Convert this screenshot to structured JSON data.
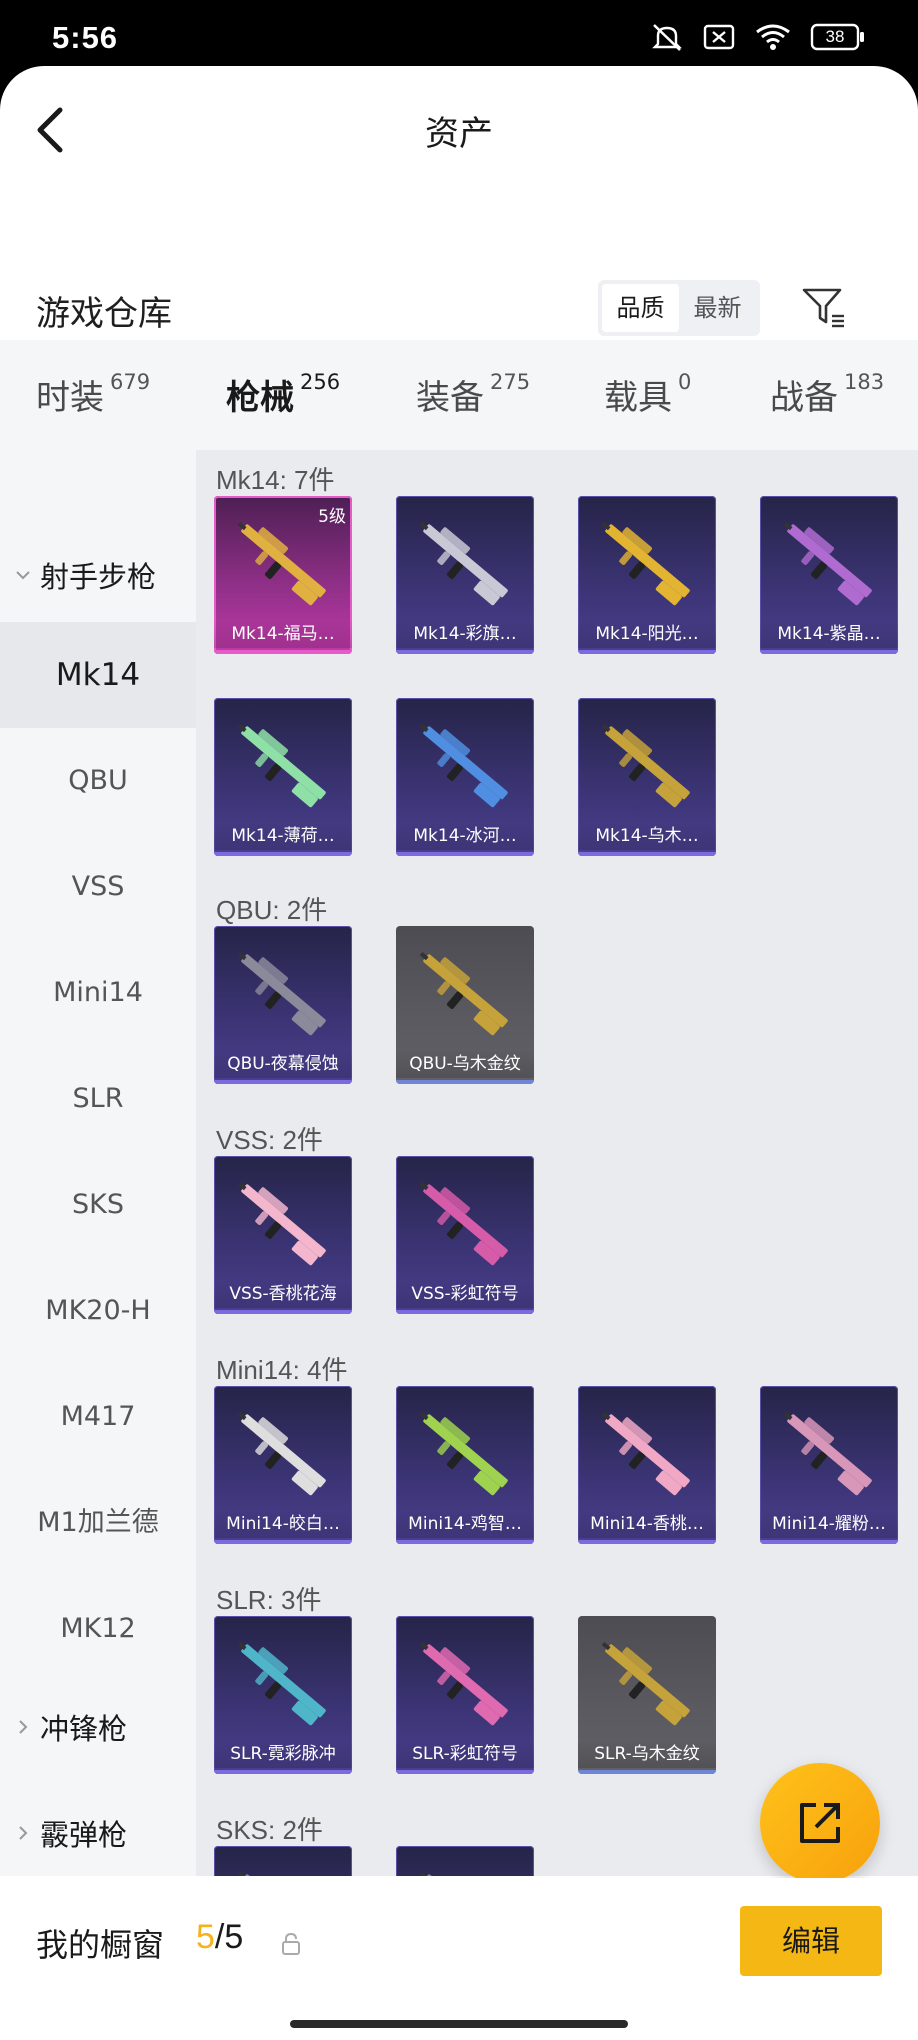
{
  "status_bar": {
    "time": "5:56",
    "battery": "38",
    "icons": [
      "silent-icon",
      "no-sim-icon",
      "wifi-icon",
      "battery-icon"
    ]
  },
  "header": {
    "title": "资产",
    "back_icon": "back-arrow-icon"
  },
  "section": {
    "title": "游戏仓库",
    "sort_options": [
      "品质",
      "最新"
    ],
    "sort_selected": "品质",
    "filter_icon": "filter-icon"
  },
  "tabs": [
    {
      "label": "时装",
      "count": "679"
    },
    {
      "label": "枪械",
      "count": "256",
      "active": true
    },
    {
      "label": "装备",
      "count": "275"
    },
    {
      "label": "载具",
      "count": "0"
    },
    {
      "label": "战备",
      "count": "183"
    }
  ],
  "sidebar": {
    "categories": [
      {
        "label": "射手步枪",
        "expanded": true
      },
      {
        "label": "冲锋枪",
        "expanded": false
      },
      {
        "label": "霰弹枪",
        "expanded": false
      }
    ],
    "items": [
      "Mk14",
      "QBU",
      "VSS",
      "Mini14",
      "SLR",
      "SKS",
      "MK20-H",
      "M417",
      "M1加兰德",
      "MK12"
    ],
    "selected": "Mk14"
  },
  "groups": [
    {
      "label": "Mk14: 7件",
      "items": [
        {
          "name": "Mk14-福马…",
          "level": "5级",
          "tier": "pink",
          "color": "#e0b040"
        },
        {
          "name": "Mk14-彩旗…",
          "tier": "purple",
          "color": "#c9c9d6"
        },
        {
          "name": "Mk14-阳光…",
          "tier": "purple",
          "color": "#e2b431"
        },
        {
          "name": "Mk14-紫晶…",
          "tier": "purple",
          "color": "#b06bd0"
        },
        {
          "name": "Mk14-薄荷…",
          "tier": "purple",
          "color": "#8fe0a6"
        },
        {
          "name": "Mk14-冰河…",
          "tier": "purple",
          "color": "#4f8ee0"
        },
        {
          "name": "Mk14-乌木…",
          "tier": "purple",
          "color": "#c6a23a"
        }
      ]
    },
    {
      "label": "QBU: 2件",
      "items": [
        {
          "name": "QBU-夜幕侵蚀",
          "tier": "purple",
          "color": "#8a8a9a"
        },
        {
          "name": "QBU-乌木金纹",
          "tier": "gray",
          "color": "#c6a23a"
        }
      ]
    },
    {
      "label": "VSS: 2件",
      "items": [
        {
          "name": "VSS-香桃花海",
          "tier": "purple",
          "color": "#f3b6cc"
        },
        {
          "name": "VSS-彩虹符号",
          "tier": "purple",
          "color": "#d65ba8"
        }
      ]
    },
    {
      "label": "Mini14: 4件",
      "items": [
        {
          "name": "Mini14-皎白…",
          "tier": "purple",
          "color": "#dedede"
        },
        {
          "name": "Mini14-鸡智…",
          "tier": "purple",
          "color": "#9ed24f"
        },
        {
          "name": "Mini14-香桃…",
          "tier": "purple",
          "color": "#f0a8c4"
        },
        {
          "name": "Mini14-耀粉…",
          "tier": "purple",
          "color": "#d896b8"
        }
      ]
    },
    {
      "label": "SLR: 3件",
      "items": [
        {
          "name": "SLR-霓彩脉冲",
          "tier": "purple",
          "color": "#4fb6c9"
        },
        {
          "name": "SLR-彩虹符号",
          "tier": "purple",
          "color": "#e06ab0"
        },
        {
          "name": "SLR-乌木金纹",
          "tier": "gray",
          "color": "#c6a23a"
        }
      ]
    },
    {
      "label": "SKS: 2件",
      "items": [
        {
          "name": "",
          "tier": "purple",
          "color": "#888"
        },
        {
          "name": "",
          "tier": "purple",
          "color": "#888"
        }
      ]
    }
  ],
  "fab": {
    "icon": "share-external-icon"
  },
  "bottom_bar": {
    "label": "我的橱窗",
    "count_current": "5",
    "count_separator": "/",
    "count_max": "5",
    "lock_icon": "lock-icon",
    "edit_label": "编辑"
  }
}
